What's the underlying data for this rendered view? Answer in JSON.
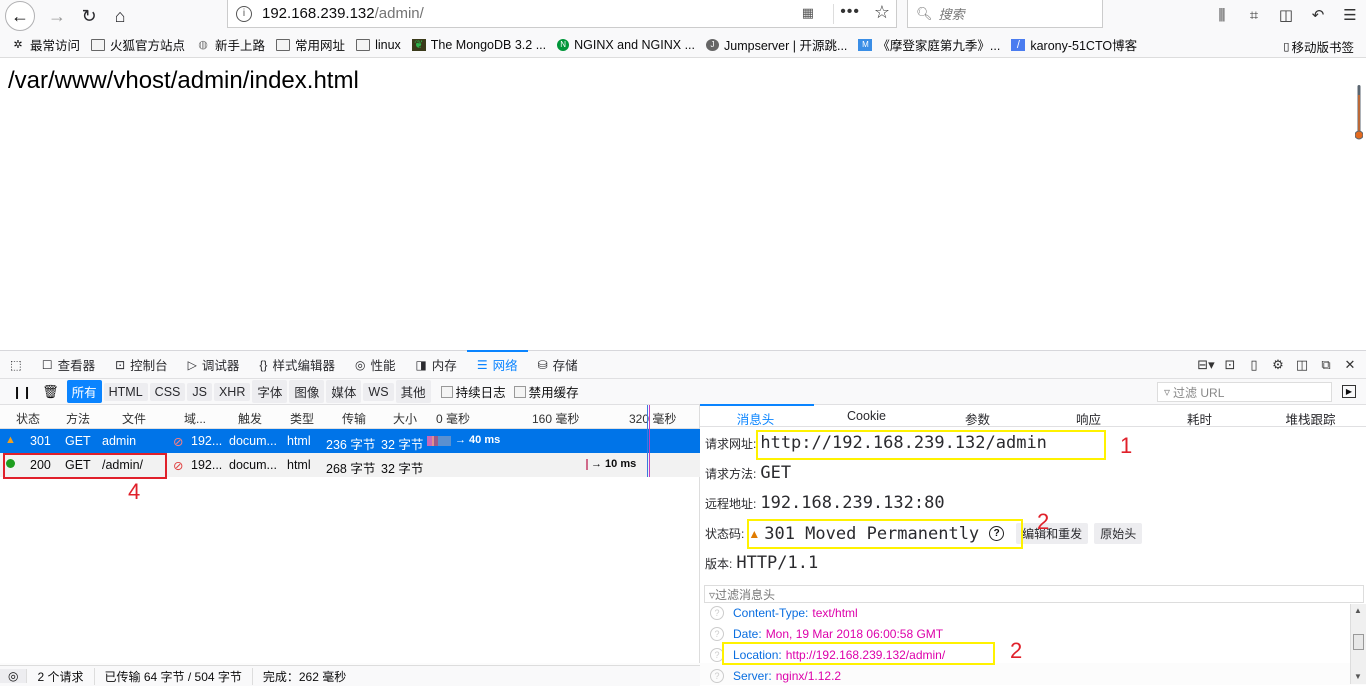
{
  "browser": {
    "url_host": "192.168.239.132",
    "url_path": "/admin/",
    "search_placeholder": "搜索",
    "bookmarks": [
      {
        "label": "最常访问",
        "icon": "gear-icon"
      },
      {
        "label": "火狐官方站点",
        "icon": "folder-icon"
      },
      {
        "label": "新手上路",
        "icon": "globe-icon"
      },
      {
        "label": "常用网址",
        "icon": "folder-icon"
      },
      {
        "label": "linux",
        "icon": "folder-icon"
      },
      {
        "label": "The MongoDB 3.2 ...",
        "icon": "mongodb-leaf-icon"
      },
      {
        "label": "NGINX and NGINX ...",
        "icon": "nginx-icon"
      },
      {
        "label": "Jumpserver | 开源跳...",
        "icon": "jumpserver-icon"
      },
      {
        "label": "《摩登家庭第九季》...",
        "icon": "site-icon"
      },
      {
        "label": "karony-51CTO博客",
        "icon": "feather-icon"
      }
    ],
    "mobile_bookmarks": "移动版书签"
  },
  "page": {
    "body_text": "/var/www/vhost/admin/index.html"
  },
  "devtools": {
    "tabs": [
      {
        "label": "查看器",
        "icon": "inspector-icon"
      },
      {
        "label": "控制台",
        "icon": "console-icon"
      },
      {
        "label": "调试器",
        "icon": "debugger-icon"
      },
      {
        "label": "样式编辑器",
        "icon": "style-editor-icon"
      },
      {
        "label": "性能",
        "icon": "performance-icon"
      },
      {
        "label": "内存",
        "icon": "memory-icon"
      },
      {
        "label": "网络",
        "icon": "network-icon",
        "active": true
      },
      {
        "label": "存储",
        "icon": "storage-icon"
      }
    ],
    "filters": [
      "所有",
      "HTML",
      "CSS",
      "JS",
      "XHR",
      "字体",
      "图像",
      "媒体",
      "WS",
      "其他"
    ],
    "persist_log": "持续日志",
    "disable_cache": "禁用缓存",
    "url_filter_placeholder": "过滤 URL",
    "columns": [
      "状态",
      "方法",
      "文件",
      "域...",
      "触发",
      "类型",
      "传输",
      "大小",
      "0 毫秒",
      "160 毫秒",
      "320 毫秒"
    ],
    "requests": [
      {
        "status": "301",
        "method": "GET",
        "file": "admin",
        "domain": "192...",
        "cause": "docum...",
        "type": "html",
        "transferred": "236 字节",
        "size": "32 字节",
        "timing": "→ 40 ms",
        "status_icon": "warning-triangle-icon",
        "selected": true
      },
      {
        "status": "200",
        "method": "GET",
        "file": "/admin/",
        "domain": "192...",
        "cause": "docum...",
        "type": "html",
        "transferred": "268 字节",
        "size": "32 字节",
        "timing": "→ 10 ms",
        "status_icon": "green-dot-icon",
        "selected": false
      }
    ],
    "detail_tabs": [
      "消息头",
      "Cookie",
      "参数",
      "响应",
      "耗时",
      "堆栈跟踪"
    ],
    "request_url_label": "请求网址:",
    "request_url": "http://192.168.239.132/admin",
    "request_method_label": "请求方法:",
    "request_method": "GET",
    "remote_address_label": "远程地址:",
    "remote_address": "192.168.239.132:80",
    "status_code_label": "状态码:",
    "status_code": "301 Moved Permanently",
    "edit_resend": "编辑和重发",
    "raw_headers": "原始头",
    "version_label": "版本:",
    "version": "HTTP/1.1",
    "header_filter_placeholder": "过滤消息头",
    "response_headers": [
      {
        "key": "Content-Type:",
        "value": "text/html"
      },
      {
        "key": "Date:",
        "value": "Mon, 19 Mar 2018 06:00:58 GMT"
      },
      {
        "key": "Location:",
        "value": "http://192.168.239.132/admin/"
      },
      {
        "key": "Server:",
        "value": "nginx/1.12.2"
      }
    ],
    "status_bar": {
      "requests": "2 个请求",
      "transferred": "已传输 64 字节 / 504 字节",
      "finish": "完成：262 毫秒"
    }
  },
  "annotations": [
    "1",
    "2",
    "2",
    "4"
  ]
}
